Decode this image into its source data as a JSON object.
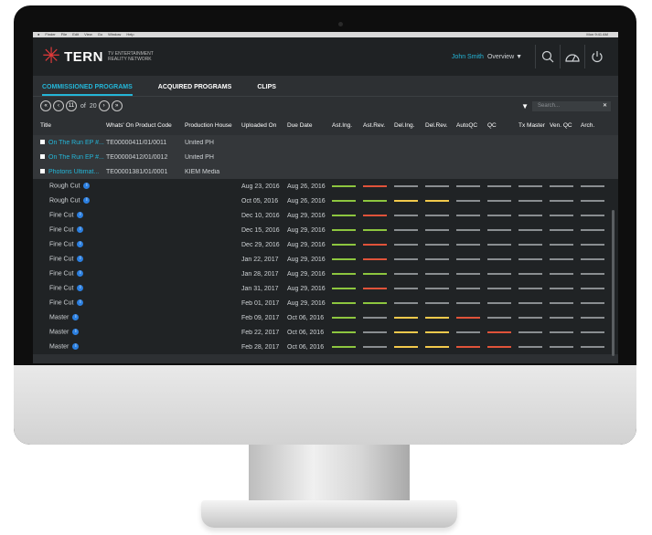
{
  "menubar": {
    "apple": "",
    "items": [
      "Finder",
      "File",
      "Edit",
      "View",
      "Go",
      "Window",
      "Help"
    ],
    "right": "Mon 9:41 AM"
  },
  "app": {
    "brand": "TERN",
    "tagline": "TV ENTERTAINMENT REALITY NETWORK",
    "user": "John Smith",
    "view": "Overview ▼"
  },
  "tabs": [
    "COMMISSIONED PROGRAMS",
    "ACQUIRED PROGRAMS",
    "CLIPS"
  ],
  "pager": {
    "prev_first": "«",
    "prev": "‹",
    "page": "11",
    "of": "of",
    "total": "20",
    "next": "›",
    "next_last": "»"
  },
  "search": {
    "placeholder": "Search...",
    "clear": "✕"
  },
  "columns": [
    "Title",
    "Whats' On Product Code",
    "Production House",
    "Uploaded On",
    "Due Date",
    "Ast.Ing.",
    "Ast.Rev.",
    "Del.Ing.",
    "Del.Rev.",
    "AutoQC",
    "QC",
    "Tx Master",
    "Ven. QC",
    "Arch."
  ],
  "colors": {
    "green": "#8dc63f",
    "red": "#e0533a",
    "yellow": "#f2c94c",
    "gray": "#8a8e91",
    "accent": "#24b6d8"
  },
  "groups": [
    {
      "title": "On The Run EP #...",
      "code": "TE00000411/01/0011",
      "house": "United PH"
    },
    {
      "title": "On The Run EP #...",
      "code": "TE00000412/01/0012",
      "house": "United PH"
    },
    {
      "title": "Photons Ultimat...",
      "code": "TE00001381/01/0001",
      "house": "KIEM Media"
    }
  ],
  "rows": [
    {
      "title": "Rough Cut",
      "up": "Aug 23, 2016",
      "due": "Aug 26, 2016",
      "st": [
        "green",
        "red",
        "gray",
        "gray",
        "gray",
        "gray",
        "gray",
        "gray",
        "gray"
      ]
    },
    {
      "title": "Rough Cut",
      "up": "Oct 05, 2016",
      "due": "Aug 26, 2016",
      "st": [
        "green",
        "green",
        "yellow",
        "yellow",
        "gray",
        "gray",
        "gray",
        "gray",
        "gray"
      ]
    },
    {
      "title": "Fine Cut",
      "up": "Dec 10, 2016",
      "due": "Aug 29, 2016",
      "st": [
        "green",
        "red",
        "gray",
        "gray",
        "gray",
        "gray",
        "gray",
        "gray",
        "gray"
      ]
    },
    {
      "title": "Fine Cut",
      "up": "Dec 15, 2016",
      "due": "Aug 29, 2016",
      "st": [
        "green",
        "green",
        "gray",
        "gray",
        "gray",
        "gray",
        "gray",
        "gray",
        "gray"
      ]
    },
    {
      "title": "Fine Cut",
      "up": "Dec 29, 2016",
      "due": "Aug 29, 2016",
      "st": [
        "green",
        "red",
        "gray",
        "gray",
        "gray",
        "gray",
        "gray",
        "gray",
        "gray"
      ]
    },
    {
      "title": "Fine Cut",
      "up": "Jan 22, 2017",
      "due": "Aug 29, 2016",
      "st": [
        "green",
        "red",
        "gray",
        "gray",
        "gray",
        "gray",
        "gray",
        "gray",
        "gray"
      ]
    },
    {
      "title": "Fine Cut",
      "up": "Jan 28, 2017",
      "due": "Aug 29, 2016",
      "st": [
        "green",
        "green",
        "gray",
        "gray",
        "gray",
        "gray",
        "gray",
        "gray",
        "gray"
      ]
    },
    {
      "title": "Fine Cut",
      "up": "Jan 31, 2017",
      "due": "Aug 29, 2016",
      "st": [
        "green",
        "red",
        "gray",
        "gray",
        "gray",
        "gray",
        "gray",
        "gray",
        "gray"
      ]
    },
    {
      "title": "Fine Cut",
      "up": "Feb 01, 2017",
      "due": "Aug 29, 2016",
      "st": [
        "green",
        "green",
        "gray",
        "gray",
        "gray",
        "gray",
        "gray",
        "gray",
        "gray"
      ]
    },
    {
      "title": "Master",
      "up": "Feb 09, 2017",
      "due": "Oct 06, 2016",
      "st": [
        "green",
        "gray",
        "yellow",
        "yellow",
        "red",
        "gray",
        "gray",
        "gray",
        "gray"
      ]
    },
    {
      "title": "Master",
      "up": "Feb 22, 2017",
      "due": "Oct 06, 2016",
      "st": [
        "green",
        "gray",
        "yellow",
        "yellow",
        "gray",
        "red",
        "gray",
        "gray",
        "gray"
      ]
    },
    {
      "title": "Master",
      "up": "Feb 28, 2017",
      "due": "Oct 06, 2016",
      "st": [
        "green",
        "gray",
        "yellow",
        "yellow",
        "red",
        "red",
        "gray",
        "gray",
        "gray"
      ]
    }
  ]
}
